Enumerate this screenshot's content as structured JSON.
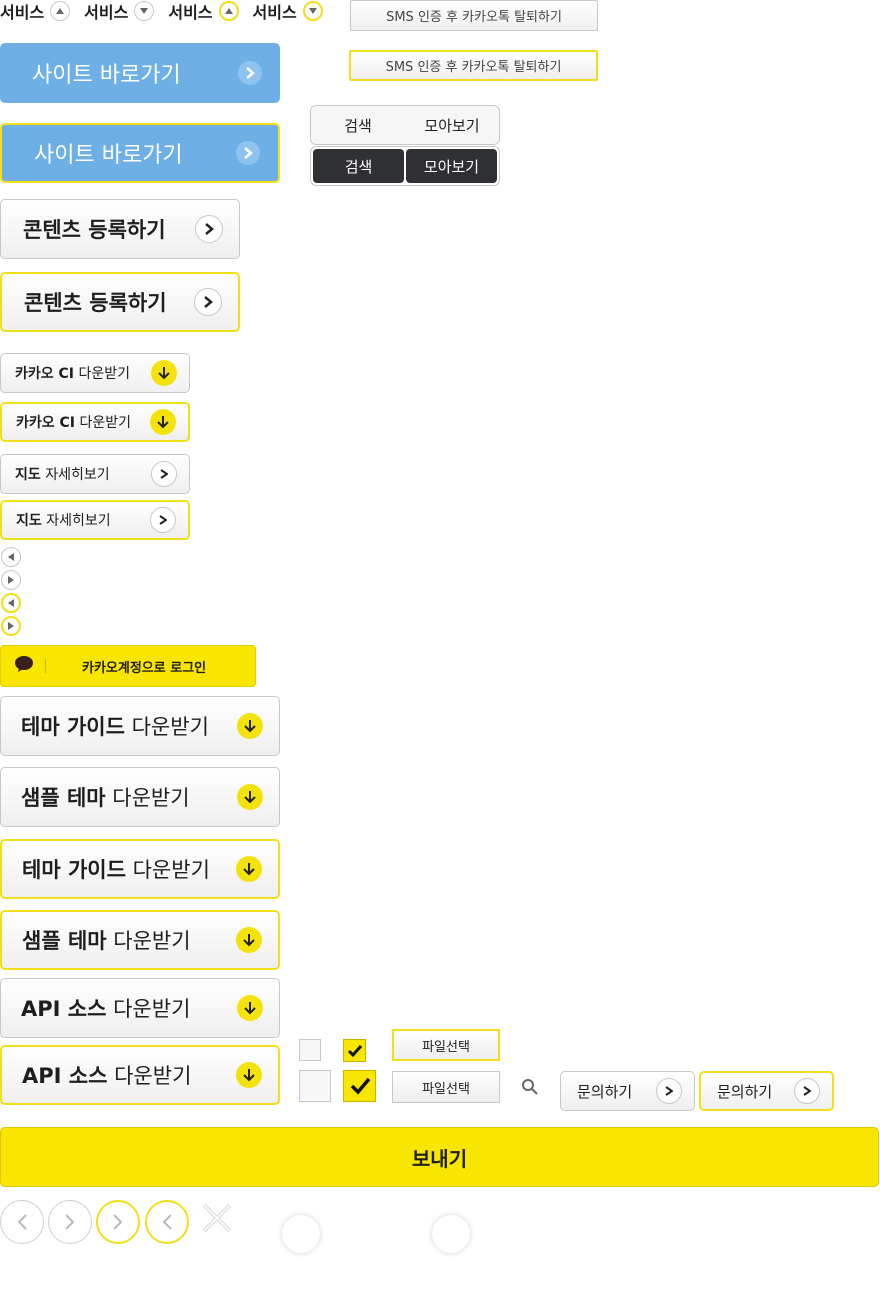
{
  "services": [
    "서비스",
    "서비스",
    "서비스",
    "서비스"
  ],
  "sms_button": "SMS 인증 후 카카오톡 탈퇴하기",
  "site_button": "사이트 바로가기",
  "content_button": "콘텐츠 등록하기",
  "segment": {
    "search": "검색",
    "collect": "모아보기"
  },
  "ci_button": {
    "bold": "카카오 CI",
    "normal": "다운받기"
  },
  "map_button": {
    "bold": "지도",
    "normal": "자세히보기"
  },
  "kakao_login": "카카오계정으로 로그인",
  "theme_guide": {
    "bold": "테마 가이드",
    "normal": "다운받기"
  },
  "sample_theme": {
    "bold": "샘플 테마",
    "normal": "다운받기"
  },
  "api_source": {
    "bold": "API 소스",
    "normal": "다운받기"
  },
  "file_select": "파일선택",
  "inquiry": "문의하기",
  "send": "보내기",
  "colors": {
    "yellow": "#f9e600",
    "blue": "#6eb0e6",
    "dark": "#2f3033"
  }
}
